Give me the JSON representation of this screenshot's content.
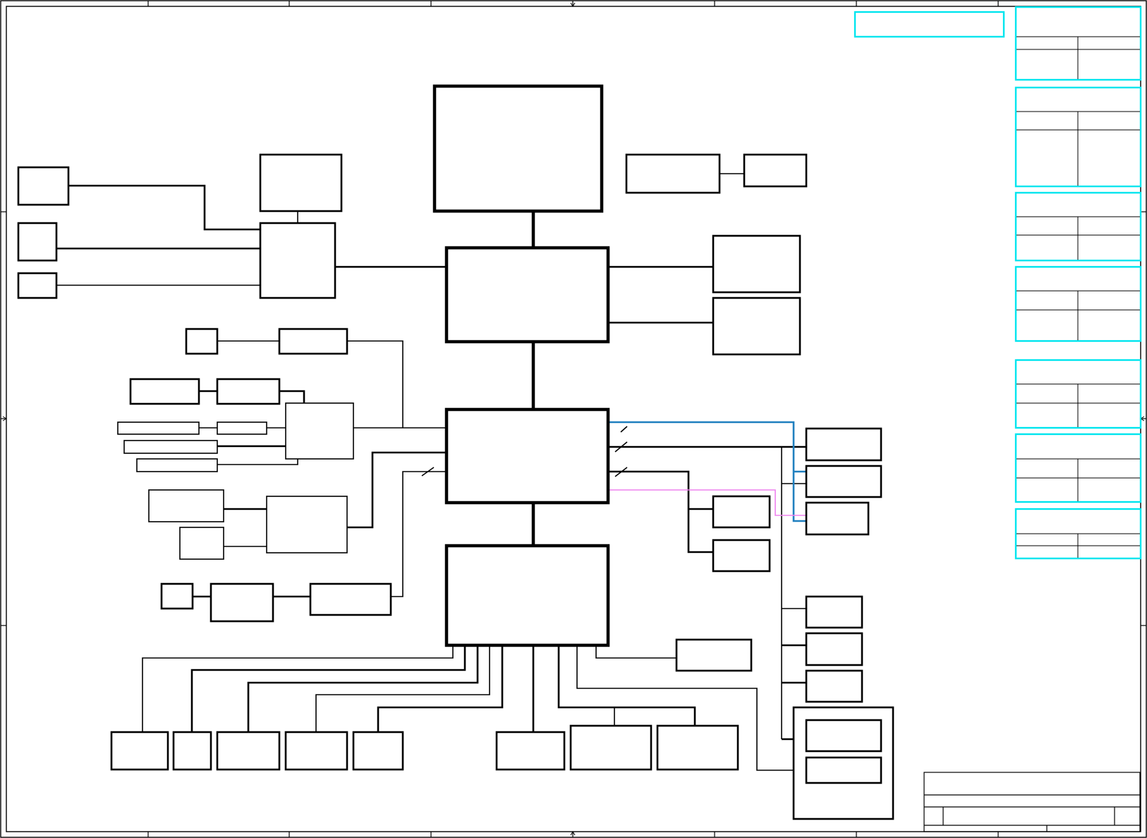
{
  "diagram": {
    "kind": "schematic block diagram",
    "line_colors": {
      "default": "#000000",
      "bus": "#1f7fbf",
      "signal": "#ee82ee",
      "sheet_frame": "#00e5ee"
    },
    "labels": []
  }
}
